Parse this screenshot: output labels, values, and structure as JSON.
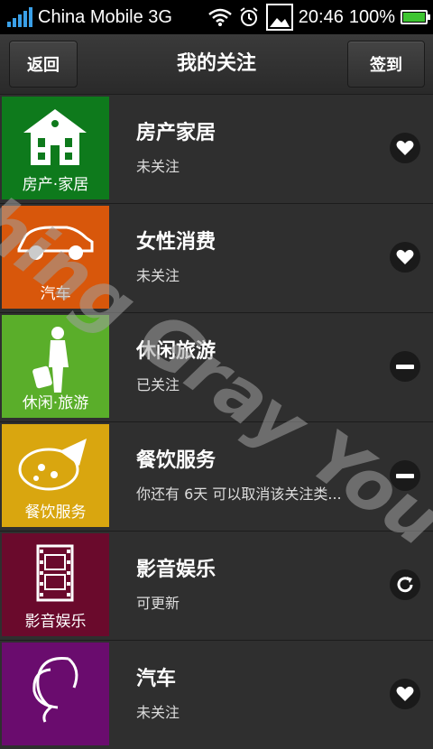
{
  "status_bar": {
    "carrier": "China Mobile 3G",
    "time": "20:46",
    "battery": "100%",
    "battery_level": 1.0,
    "icons": [
      "signal-icon",
      "wifi-icon",
      "alarm-icon",
      "image-icon",
      "battery-icon"
    ]
  },
  "header": {
    "back_label": "返回",
    "title": "我的关注",
    "checkin_label": "签到"
  },
  "items": [
    {
      "tile_label": "房产·家居",
      "title": "房产家居",
      "status": "未关注",
      "action": "heart",
      "tile_color": "#0e7a1c",
      "icon": "house-icon"
    },
    {
      "tile_label": "汽车",
      "title": "女性消费",
      "status": "未关注",
      "action": "heart",
      "tile_color": "#d8570b",
      "icon": "car-icon"
    },
    {
      "tile_label": "休闲·旅游",
      "title": "休闲旅游",
      "status": "已关注",
      "action": "minus",
      "tile_color": "#5aae2a",
      "icon": "traveler-icon"
    },
    {
      "tile_label": "餐饮服务",
      "title": "餐饮服务",
      "status": "你还有 6天 可以取消该关注类...",
      "action": "minus",
      "tile_color": "#d9a60f",
      "icon": "pizza-icon"
    },
    {
      "tile_label": "影音娱乐",
      "title": "影音娱乐",
      "status": "可更新",
      "action": "refresh",
      "tile_color": "#6a0a2c",
      "icon": "film-icon"
    },
    {
      "tile_label": "",
      "title": "汽车",
      "status": "未关注",
      "action": "heart",
      "tile_color": "#6a0c6e",
      "icon": "woman-face-icon"
    }
  ],
  "watermark": "ching Gray You"
}
